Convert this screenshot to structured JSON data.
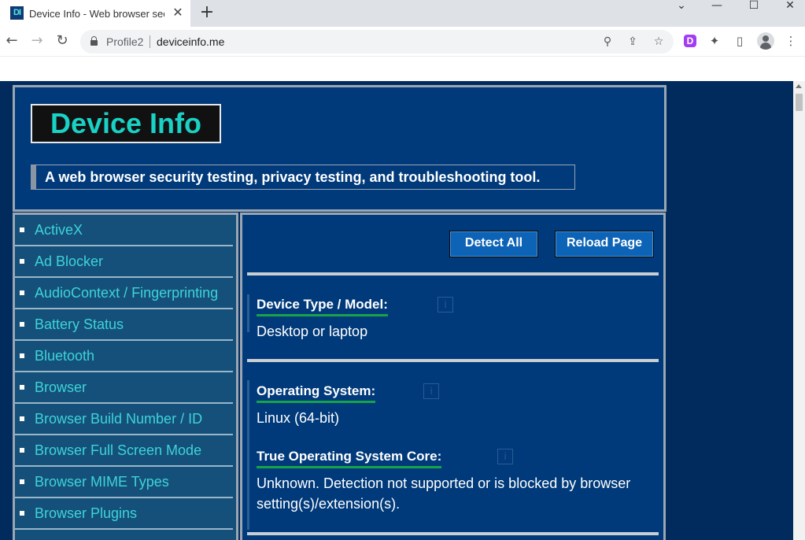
{
  "browser": {
    "tab": {
      "favicon_text": "DI",
      "title": "Device Info - Web browser security",
      "close_glyph": "✕"
    },
    "new_tab_glyph": "+",
    "window_controls": {
      "minimize": "—",
      "maximize": "☐",
      "close": "✕",
      "menu": "⌄"
    },
    "nav": {
      "back": "←",
      "forward": "→",
      "reload": "↻"
    },
    "omnibox": {
      "profile_label": "Profile2",
      "url": "deviceinfo.me"
    },
    "icons": {
      "search": "⚲",
      "share": "⇪",
      "bookmark": "☆",
      "extension_d": "D",
      "extensions": "✦",
      "side_panel": "▯",
      "menu": "⋮"
    }
  },
  "site": {
    "logo": "Device Info",
    "tagline": "A web browser security testing, privacy testing, and troubleshooting tool."
  },
  "sidebar": {
    "items": [
      {
        "label": "ActiveX"
      },
      {
        "label": "Ad Blocker"
      },
      {
        "label": "AudioContext / Fingerprinting"
      },
      {
        "label": "Battery Status"
      },
      {
        "label": "Bluetooth"
      },
      {
        "label": "Browser"
      },
      {
        "label": "Browser Build Number / ID"
      },
      {
        "label": "Browser Full Screen Mode"
      },
      {
        "label": "Browser MIME Types"
      },
      {
        "label": "Browser Plugins"
      }
    ]
  },
  "main": {
    "buttons": {
      "detect_all": "Detect All",
      "reload_page": "Reload Page"
    },
    "info_glyph": "i",
    "items": [
      {
        "label": "Device Type / Model:",
        "value": "Desktop or laptop"
      },
      {
        "label": "Operating System:",
        "value": "Linux (64-bit)"
      },
      {
        "label": "True Operating System Core:",
        "value": "Unknown. Detection not supported or is blocked by browser setting(s)/extension(s)."
      }
    ]
  },
  "colors": {
    "page_bg": "#002b5c",
    "panel_bg": "#003a7a",
    "sidebar_bg": "#14507a",
    "link": "#3fd3d8",
    "logo_text": "#19d1c4",
    "underline_green": "#16a34a",
    "button_bg": "#0d63b6"
  }
}
